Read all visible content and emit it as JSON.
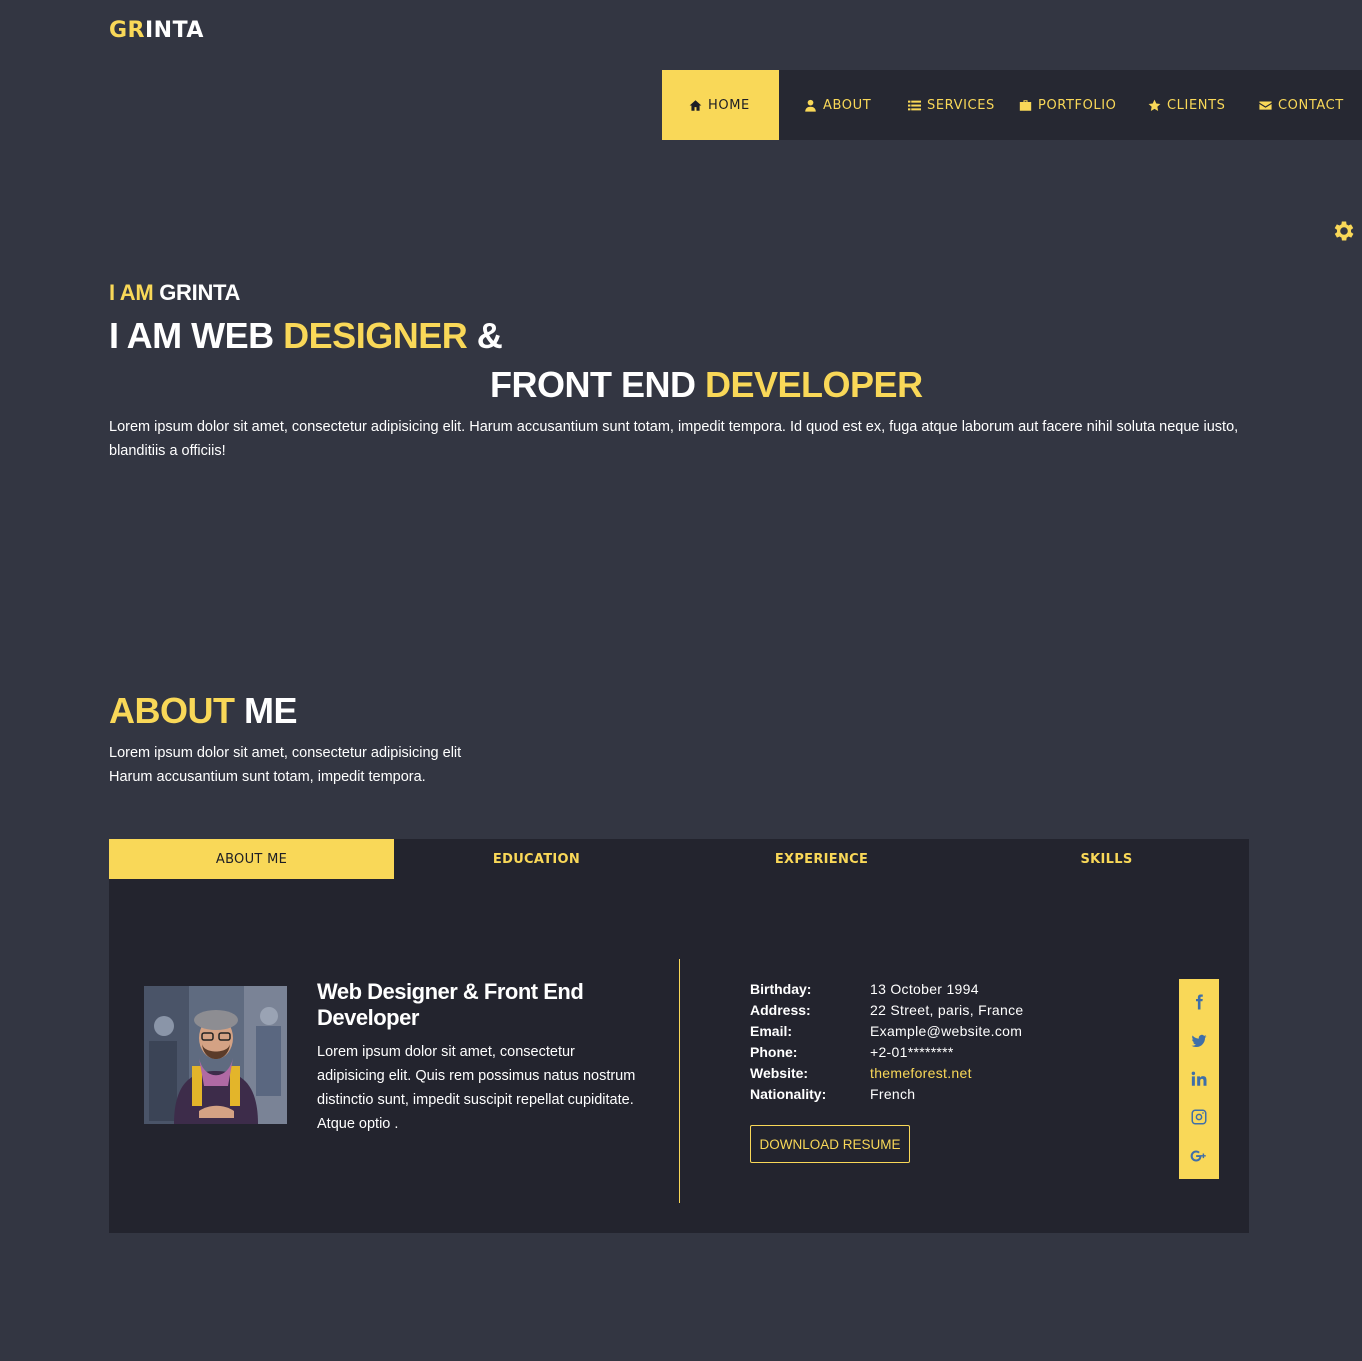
{
  "brand": {
    "part1": "GR",
    "part2": "INTA"
  },
  "nav": {
    "items": [
      {
        "label": "HOME",
        "icon": "home-icon",
        "active": true
      },
      {
        "label": "ABOUT",
        "icon": "user-icon"
      },
      {
        "label": "SERVICES",
        "icon": "list-icon"
      },
      {
        "label": "PORTFOLIO",
        "icon": "briefcase-icon"
      },
      {
        "label": "CLIENTS",
        "icon": "star-icon"
      },
      {
        "label": "CONTACT",
        "icon": "envelope-icon"
      }
    ]
  },
  "hero": {
    "intro_a": "I AM",
    "intro_b": "GRINTA",
    "line1_a": "I AM WEB",
    "line1_b": "DESIGNER",
    "line1_c": "&",
    "line2_a": "FRONT END",
    "line2_b": "DEVELOPER",
    "description": "Lorem ipsum dolor sit amet, consectetur adipisicing elit. Harum accusantium sunt totam, impedit tempora. Id quod est ex, fuga atque laborum aut facere nihil soluta neque iusto, blanditiis a officiis!"
  },
  "about": {
    "title_a": "ABOUT",
    "title_b": "ME",
    "desc_line1": "Lorem ipsum dolor sit amet, consectetur adipisicing elit",
    "desc_line2": "Harum accusantium sunt totam, impedit tempora.",
    "tabs": [
      {
        "label": "ABOUT ME",
        "active": true
      },
      {
        "label": "EDUCATION"
      },
      {
        "label": "EXPERIENCE"
      },
      {
        "label": "SKILLS"
      }
    ],
    "profile_title": "Web Designer & Front End Developer",
    "profile_text": "Lorem ipsum dolor sit amet, consectetur adipisicing elit. Quis rem possimus natus nostrum distinctio sunt, impedit suscipit repellat cupiditate. Atque optio .",
    "info": [
      {
        "label": "Birthday:",
        "value": "13 October 1994"
      },
      {
        "label": "Address:",
        "value": "22 Street, paris, France"
      },
      {
        "label": "Email:",
        "value": "Example@website.com"
      },
      {
        "label": "Phone:",
        "value": "+2-01********"
      },
      {
        "label": "Website:",
        "value": "themeforest.net"
      },
      {
        "label": "Nationality:",
        "value": "French"
      }
    ],
    "download_label": "DOWNLOAD RESUME",
    "social_icons": [
      "facebook-icon",
      "twitter-icon",
      "linkedin-icon",
      "instagram-icon",
      "google-plus-icon"
    ]
  },
  "colors": {
    "accent": "#f9d858",
    "background": "#333642",
    "panel": "#23242e",
    "social_icon": "#3f6fa8"
  }
}
